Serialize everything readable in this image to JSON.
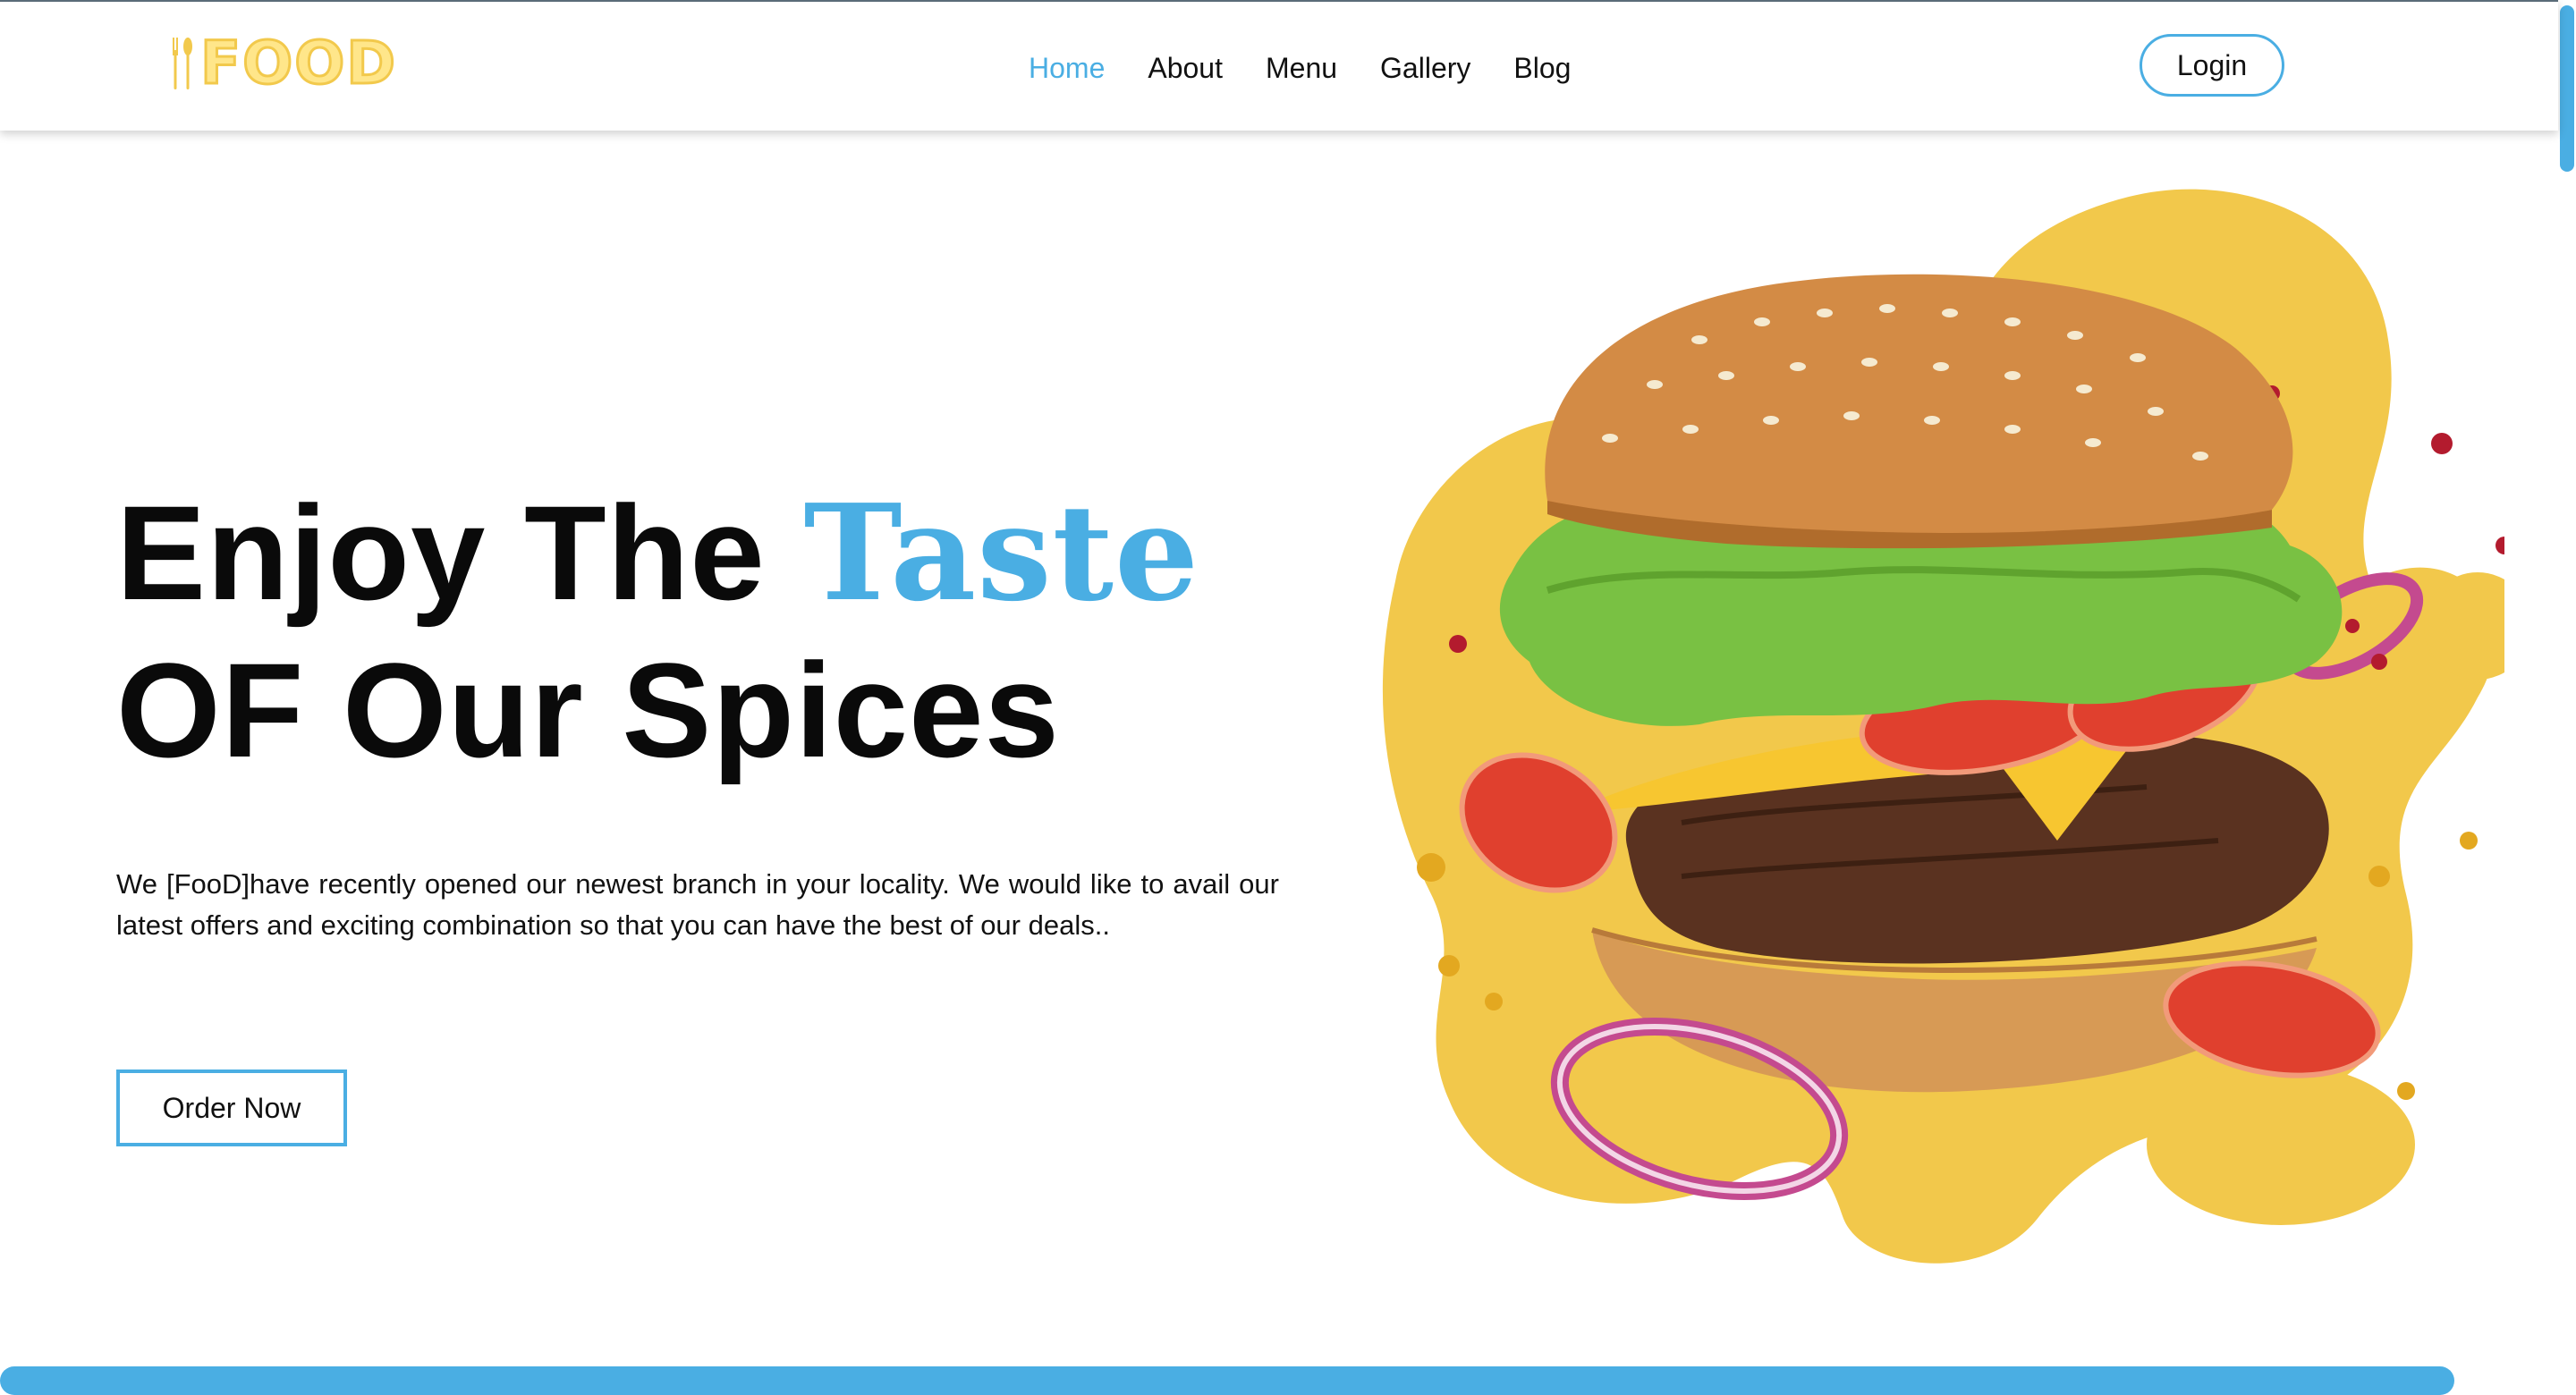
{
  "brand": {
    "logo_text": "FOOD",
    "logo_color": "#f2c94c",
    "icon": "fork-spoon-icon"
  },
  "nav": {
    "items": [
      {
        "label": "Home",
        "active": true
      },
      {
        "label": "About",
        "active": false
      },
      {
        "label": "Menu",
        "active": false
      },
      {
        "label": "Gallery",
        "active": false
      },
      {
        "label": "Blog",
        "active": false
      }
    ],
    "login_label": "Login"
  },
  "hero": {
    "headline_part1": "Enjoy The",
    "headline_accent": "Taste",
    "headline_part2": "OF Our Spices",
    "description": "We [FooD]have recently opened our newest branch in your locality. We would like to avail our latest offers and exciting combination so that you can have the best of our deals..",
    "cta_label": "Order Now",
    "image": "burger-illustration"
  },
  "colors": {
    "accent": "#4aaee3",
    "brand_yellow": "#f2c94c",
    "text": "#0a0a0a"
  }
}
